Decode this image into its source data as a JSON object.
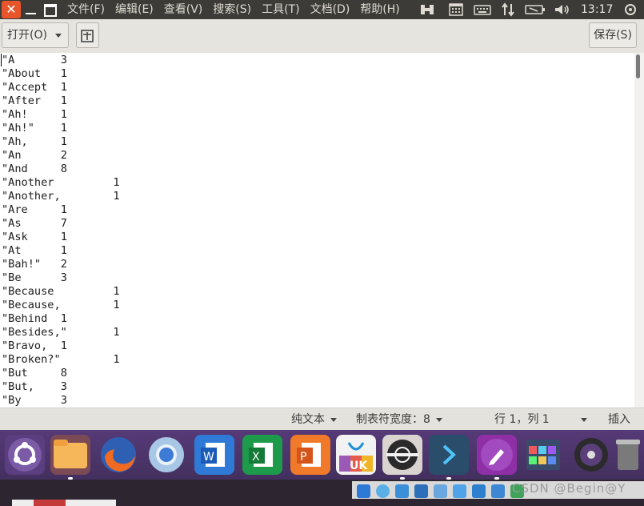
{
  "topbar": {
    "close_glyph": "✕",
    "menus": [
      "文件(F)",
      "编辑(E)",
      "查看(V)",
      "搜索(S)",
      "工具(T)",
      "文档(D)",
      "帮助(H)"
    ],
    "clock": "13:17"
  },
  "toolbar": {
    "open_label": "打开(O)",
    "save_label": "保存(S)"
  },
  "document": {
    "lines": [
      [
        "\"A",
        "3"
      ],
      [
        "\"About",
        "1"
      ],
      [
        "\"Accept",
        "1"
      ],
      [
        "\"After",
        "1"
      ],
      [
        "\"Ah!",
        "1"
      ],
      [
        "\"Ah!\"",
        "1"
      ],
      [
        "\"Ah,",
        "1"
      ],
      [
        "\"An",
        "2"
      ],
      [
        "\"And",
        "8"
      ],
      [
        "\"Another",
        "1"
      ],
      [
        "\"Another,",
        "1"
      ],
      [
        "\"Are",
        "1"
      ],
      [
        "\"As",
        "7"
      ],
      [
        "\"Ask",
        "1"
      ],
      [
        "\"At",
        "1"
      ],
      [
        "\"Bah!\"",
        "2"
      ],
      [
        "\"Be",
        "3"
      ],
      [
        "\"Because",
        "1"
      ],
      [
        "\"Because,",
        "1"
      ],
      [
        "\"Behind",
        "1"
      ],
      [
        "\"Besides,\"",
        "1"
      ],
      [
        "\"Bravo,",
        "1"
      ],
      [
        "\"Broken?\"",
        "1"
      ],
      [
        "\"But",
        "8"
      ],
      [
        "\"But,",
        "3"
      ],
      [
        "\"By",
        "3"
      ]
    ]
  },
  "statusbar": {
    "syntax": "纯文本",
    "tab_width": "制表符宽度：8",
    "position": "行 1，列 1",
    "mode": "插入"
  },
  "dock": {
    "apps": [
      "ubuntu-logo",
      "files",
      "firefox",
      "chromium",
      "wps-writer",
      "wps-spreadsheet",
      "wps-presentation",
      "ubuntu-software",
      "system-settings",
      "vscode",
      "text-editor",
      "app-grid",
      "disc-burner",
      "trash"
    ]
  },
  "tray": {
    "watermark": "CSDN @Begin@Y"
  },
  "colors": {
    "topbar_bg": "#3c3b37",
    "close_red": "#e8552b",
    "dock_purple": "#4e3570"
  }
}
